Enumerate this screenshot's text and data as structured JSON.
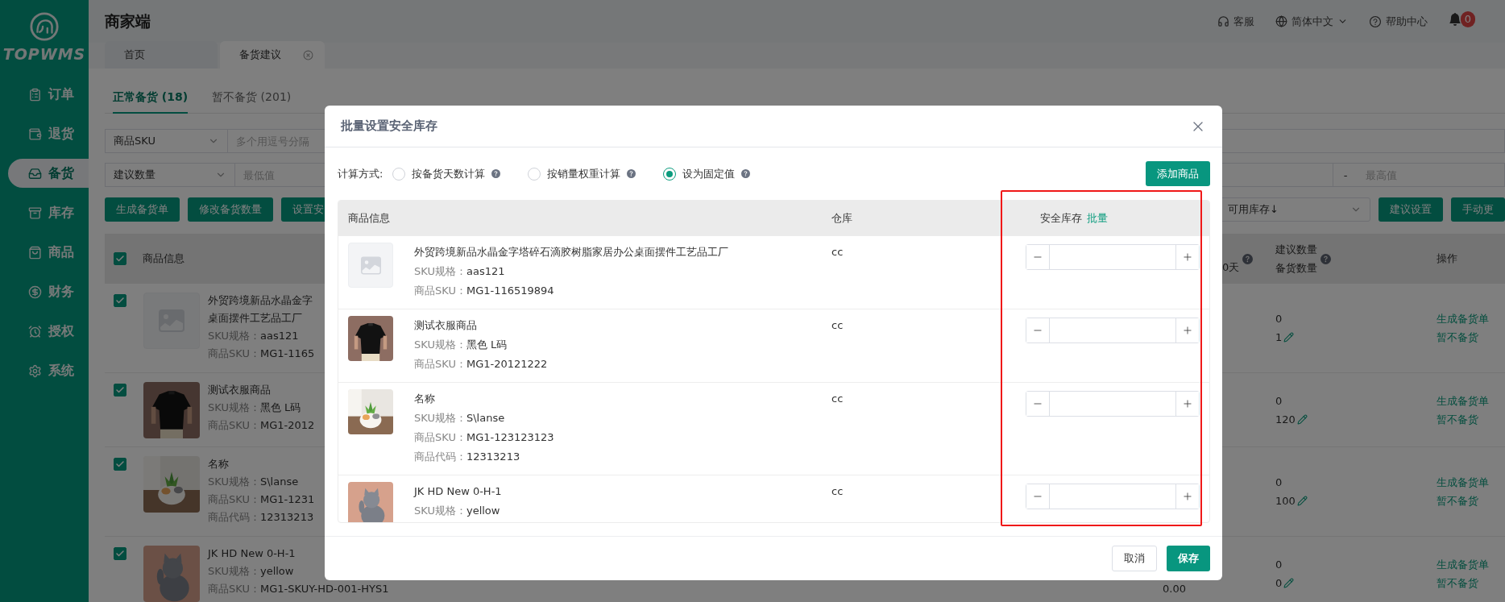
{
  "sidebar": {
    "logo": "TOPWMS",
    "items": [
      {
        "label": "订单",
        "selected": false
      },
      {
        "label": "退货",
        "selected": false
      },
      {
        "label": "备货",
        "selected": true
      },
      {
        "label": "库存",
        "selected": false
      },
      {
        "label": "商品",
        "selected": false
      },
      {
        "label": "财务",
        "selected": false
      },
      {
        "label": "授权",
        "selected": false
      },
      {
        "label": "系统",
        "selected": false
      }
    ]
  },
  "header": {
    "title": "商家端",
    "links": [
      {
        "label": "客服",
        "has_menu": false
      },
      {
        "label": "简体中文",
        "has_menu": true
      },
      {
        "label": "帮助中心",
        "has_menu": false
      }
    ],
    "notifications": "0"
  },
  "page_tabs": [
    {
      "label": "首页",
      "selected": false,
      "closable": false
    },
    {
      "label": "备货建议",
      "selected": true,
      "closable": true
    }
  ],
  "subtabs": [
    {
      "label": "正常备货 (18)",
      "selected": true
    },
    {
      "label": "暂不备货 (201)",
      "selected": false
    }
  ],
  "filters": {
    "row_1": {
      "select": "商品SKU",
      "placeholder": "多个用逗号分隔"
    },
    "row_2": {
      "select": "建议数量",
      "min_placeholder": "最低值",
      "separator": "-",
      "max_placeholder": "最高值"
    }
  },
  "toolbar": {
    "buttons": [
      "生成备货单",
      "修改备货数量",
      "设置安"
    ],
    "sort_select": "可用库存↓",
    "right_buttons": [
      "建议设置",
      "手动更"
    ]
  },
  "table": {
    "header_checked": true,
    "columns": {
      "info": "商品信息",
      "days": "0天",
      "qty": [
        "建议数量",
        "备货数量"
      ],
      "actions": "操作"
    },
    "rows": [
      {
        "checked": true,
        "image": {
          "kind": "placeholder"
        },
        "name": [
          "外贸跨境新品水晶金字",
          "桌面摆件工艺品工厂"
        ],
        "lines": [
          {
            "label": "SKU规格：",
            "value": "aas121"
          },
          {
            "label": "商品SKU：",
            "value": "MG1-1165"
          }
        ],
        "suggested": "0",
        "stock_qty": "1",
        "actions": [
          "生成备货单",
          "暂不备货"
        ]
      },
      {
        "checked": true,
        "image": {
          "kind": "picture"
        },
        "name": [
          "测试衣服商品"
        ],
        "lines": [
          {
            "label": "SKU规格：",
            "value": "黑色 L码"
          },
          {
            "label": "商品SKU：",
            "value": "MG1-2012"
          }
        ],
        "suggested": "0",
        "stock_qty": "120",
        "actions": [
          "生成备货单",
          "暂不备货"
        ]
      },
      {
        "checked": true,
        "image": {
          "kind": "picture"
        },
        "name": [
          "名称"
        ],
        "lines": [
          {
            "label": "SKU规格：",
            "value": "S\\lanse"
          },
          {
            "label": "商品SKU：",
            "value": "MG1-1231"
          },
          {
            "label": "商品代码：",
            "value": "12313213"
          }
        ],
        "suggested": "0",
        "stock_qty": "100",
        "actions": [
          "生成备货单",
          "暂不备货"
        ]
      },
      {
        "checked": true,
        "image": {
          "kind": "picture"
        },
        "name": [
          "JK HD New 0-H-1"
        ],
        "lines": [
          {
            "label": "SKU规格：",
            "value": "yellow"
          },
          {
            "label": "商品SKU：",
            "value": "MG1-SKUY-HD-001-HYS1"
          }
        ],
        "column_4": "0.00",
        "suggested": "0",
        "stock_qty": "0",
        "actions": [
          "生成备货单",
          "暂不备货"
        ]
      }
    ]
  },
  "dialog": {
    "title": "批量设置安全库存",
    "method_label": "计算方式:",
    "methods": [
      {
        "label": "按备货天数计算",
        "selected": false
      },
      {
        "label": "按销量权重计算",
        "selected": false
      },
      {
        "label": "设为固定值",
        "selected": true
      }
    ],
    "add_button": "添加商品",
    "columns": {
      "info": "商品信息",
      "warehouse": "仓库",
      "safety_stock": "安全库存",
      "batch_link": "批量"
    },
    "rows": [
      {
        "image": {
          "kind": "placeholder"
        },
        "name": "外贸跨境新品水晶金字塔碎石滴胶树脂家居办公桌面摆件工艺品工厂",
        "lines": [
          {
            "label": "SKU规格：",
            "value": "aas121"
          },
          {
            "label": "商品SKU：",
            "value": "MG1-116519894"
          }
        ],
        "warehouse": "cc"
      },
      {
        "image": {
          "kind": "picture"
        },
        "name": "测试衣服商品",
        "lines": [
          {
            "label": "SKU规格：",
            "value": "黑色 L码"
          },
          {
            "label": "商品SKU：",
            "value": "MG1-20121222"
          }
        ],
        "warehouse": "cc"
      },
      {
        "image": {
          "kind": "picture"
        },
        "name": "名称",
        "lines": [
          {
            "label": "SKU规格：",
            "value": "S\\lanse"
          },
          {
            "label": "商品SKU：",
            "value": "MG1-123123123"
          },
          {
            "label": "商品代码：",
            "value": "12313213"
          }
        ],
        "warehouse": "cc"
      },
      {
        "image": {
          "kind": "picture"
        },
        "name": "JK HD New 0-H-1",
        "lines": [
          {
            "label": "SKU规格：",
            "value": "yellow"
          }
        ],
        "warehouse": "cc"
      }
    ],
    "buttons": {
      "cancel": "取消",
      "save": "保存"
    }
  }
}
